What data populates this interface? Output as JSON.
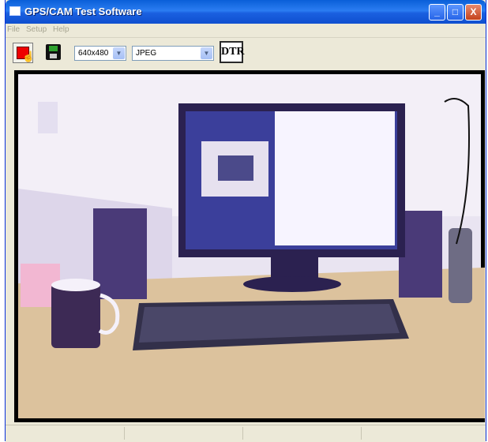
{
  "window": {
    "title": "GPS/CAM Test Software"
  },
  "titlebar_buttons": {
    "minimize": "_",
    "maximize": "□",
    "close": "X"
  },
  "menu": [
    "File",
    "Setup",
    "Help"
  ],
  "toolbar": {
    "record_icon": "record-cursor-icon",
    "save_icon": "floppy-disk-icon",
    "resolution_value": "640x480",
    "format_value": "JPEG",
    "dtr_label": "DTR"
  },
  "video": {
    "content": "live camera feed"
  },
  "colors": {
    "titlebar": "#1a60e0",
    "close": "#c4421c",
    "window_bg": "#ece9d8"
  }
}
